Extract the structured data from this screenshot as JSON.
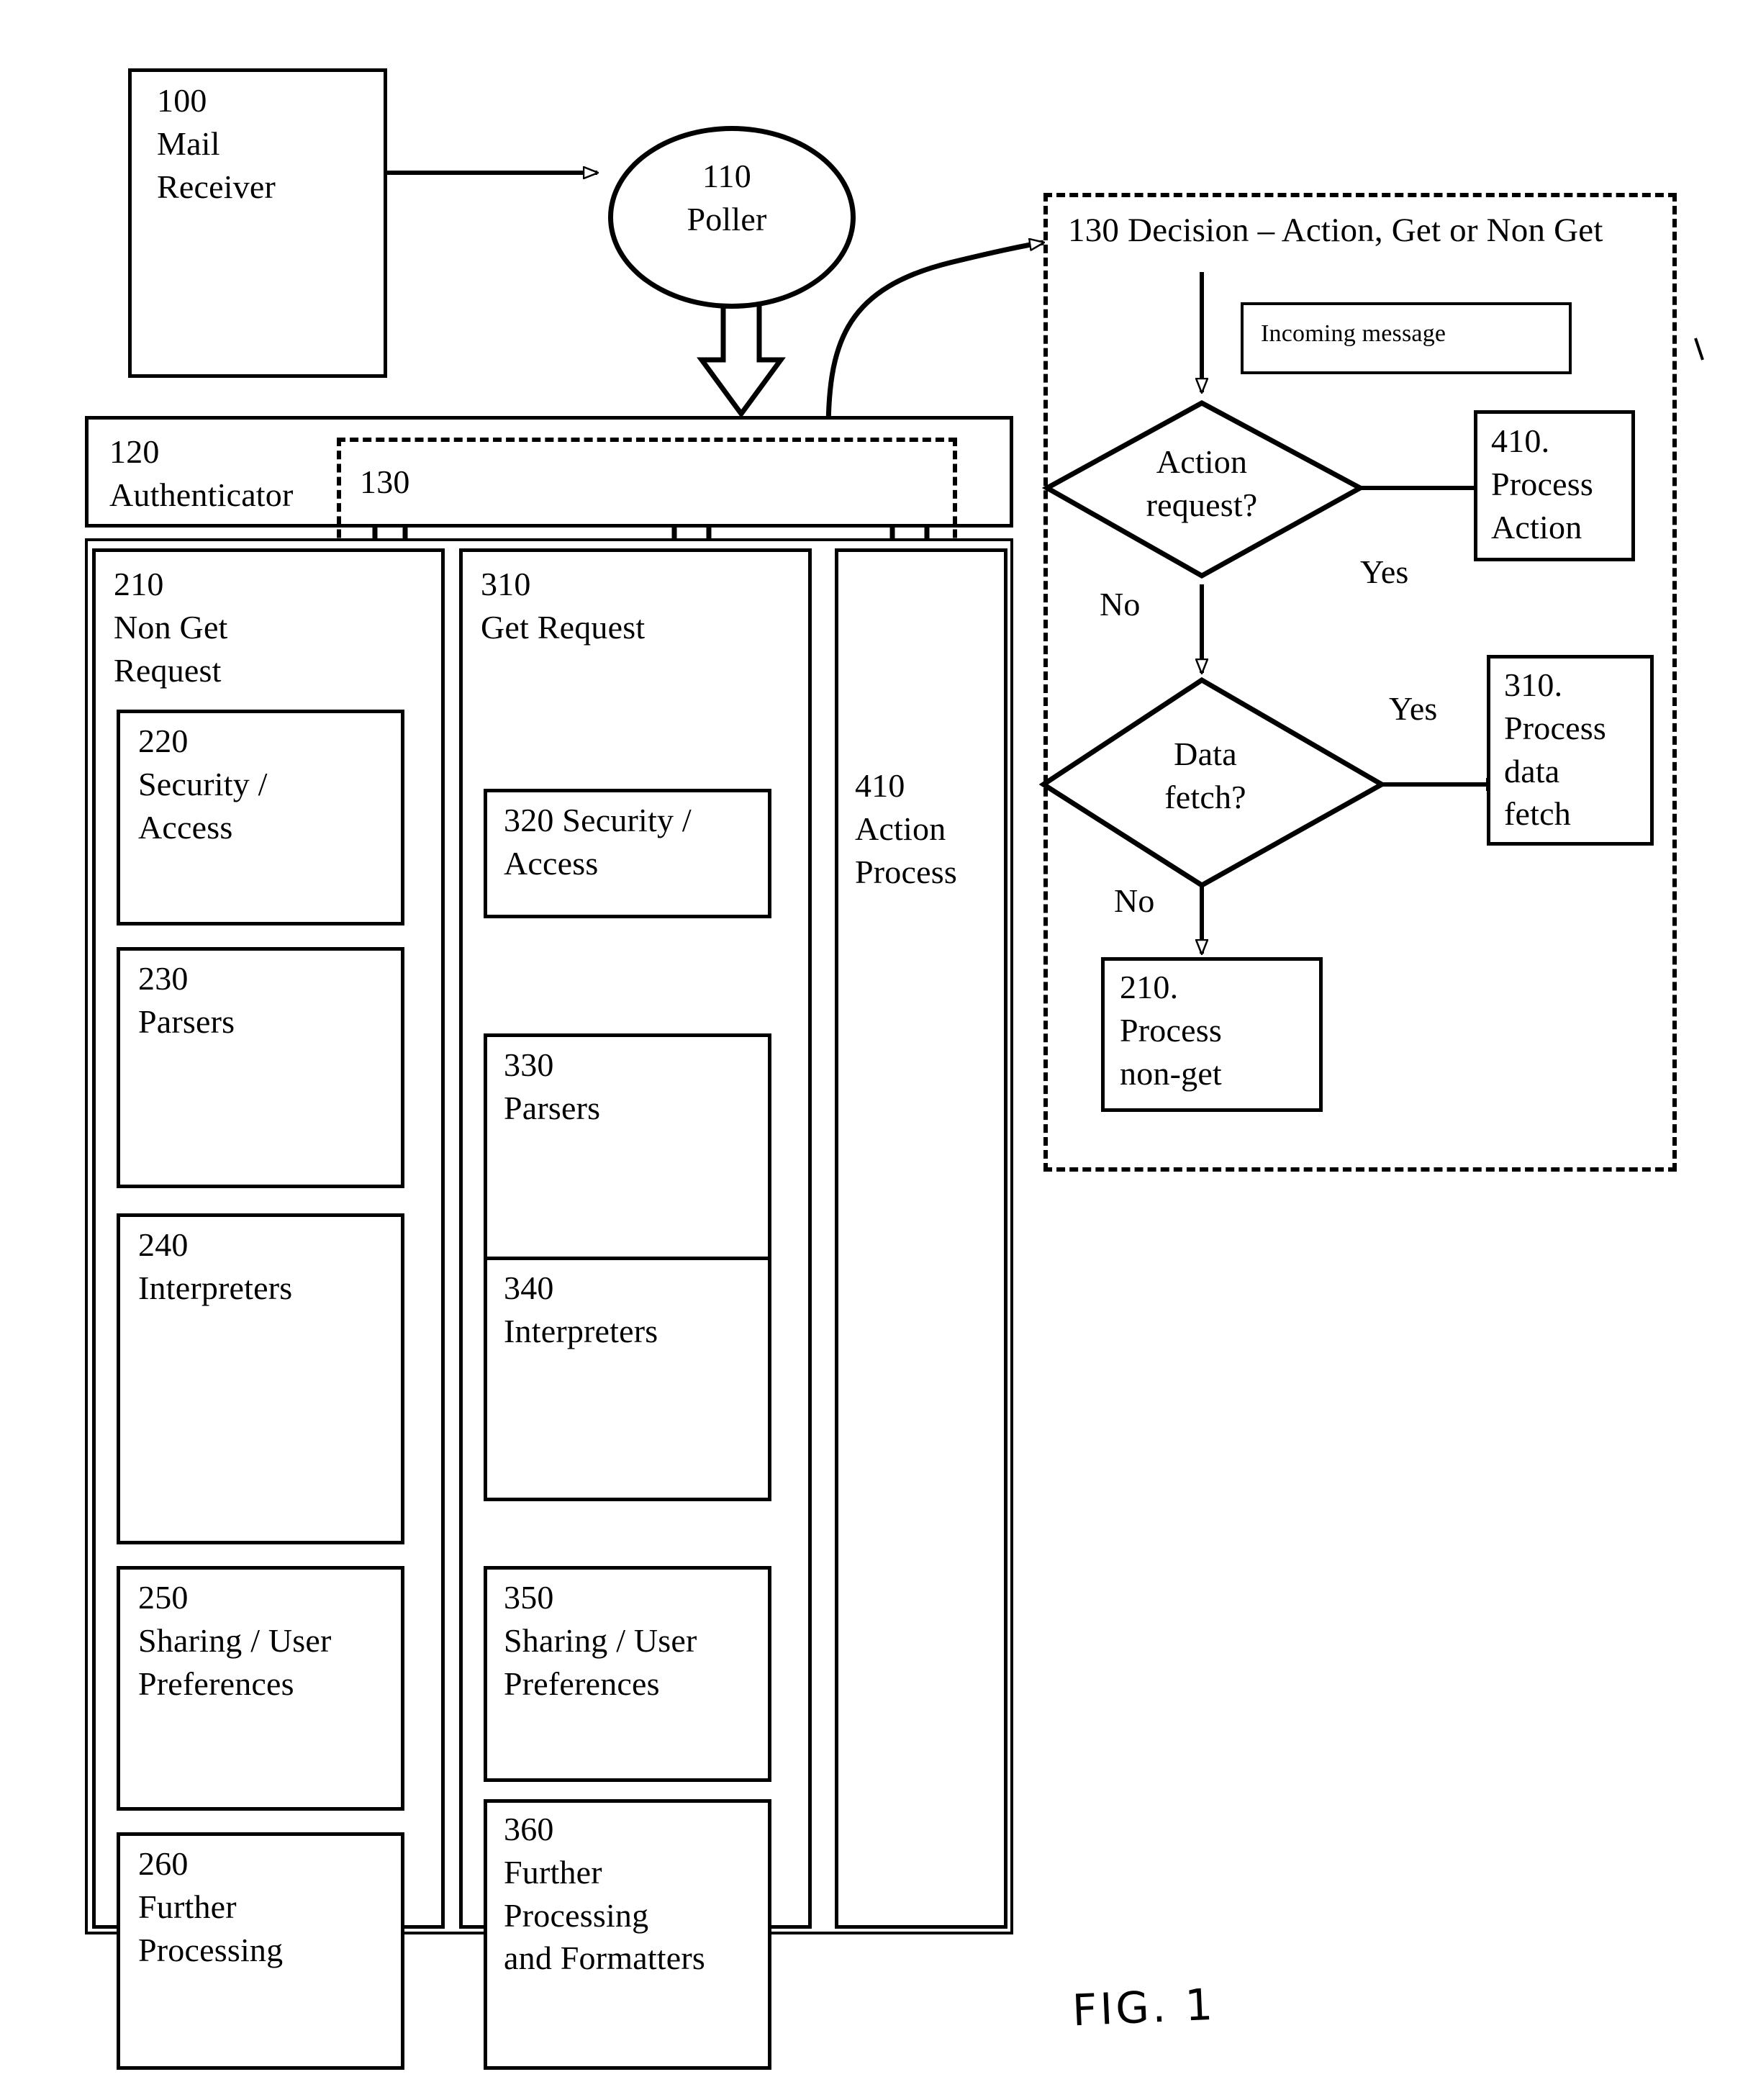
{
  "figure": {
    "label": "FIG. 1",
    "title": "Mail processing architecture block diagram"
  },
  "nodes": {
    "mail_receiver": {
      "id": "100",
      "name": "Mail\nReceiver",
      "text": "100\nMail\nReceiver"
    },
    "poller": {
      "id": "110",
      "name": "Poller",
      "text": "110\nPoller"
    },
    "authenticator": {
      "id": "120",
      "name": "Authenticator",
      "text": "120\nAuthenticator"
    },
    "decision_inline": {
      "id": "130",
      "text": "130"
    },
    "non_get_request": {
      "id": "210",
      "name": "Non Get Request",
      "text": "210\nNon Get\nRequest"
    },
    "get_request": {
      "id": "310",
      "name": "Get Request",
      "text": "310\nGet Request"
    },
    "action_process": {
      "id": "410",
      "name": "Action Process",
      "text": "410\nAction\nProcess"
    },
    "security_access_nonget": {
      "id": "220",
      "text": "220\nSecurity /\nAccess"
    },
    "parsers_nonget": {
      "id": "230",
      "text": "230\nParsers"
    },
    "interpreters_nonget": {
      "id": "240",
      "text": "240\nInterpreters"
    },
    "sharing_prefs_nonget": {
      "id": "250",
      "text": "250\nSharing / User\nPreferences"
    },
    "further_processing_nonget": {
      "id": "260",
      "text": "260\nFurther\nProcessing"
    },
    "security_access_get": {
      "id": "320",
      "text": "320 Security /\nAccess"
    },
    "parsers_get": {
      "id": "330",
      "text": "330\nParsers"
    },
    "interpreters_get": {
      "id": "340",
      "text": "340\nInterpreters"
    },
    "sharing_prefs_get": {
      "id": "350",
      "text": "350\nSharing / User\nPreferences"
    },
    "further_processing_get": {
      "id": "360",
      "text": "360\nFurther\nProcessing\nand Formatters"
    }
  },
  "decision_panel": {
    "title": "130 Decision – Action, Get or Non Get",
    "incoming_message": "Incoming message",
    "diamond_action": "Action\nrequest?",
    "diamond_data": "Data\nfetch?",
    "process_action": "410.\nProcess\nAction",
    "process_data_fetch": "310.\nProcess\ndata\nfetch",
    "process_non_get": "210.\nProcess\nnon-get",
    "edge_labels": {
      "action_yes": "Yes",
      "action_no": "No",
      "data_yes": "Yes",
      "data_no": "No"
    }
  },
  "style": {
    "ink": "#000000",
    "paper": "#ffffff"
  }
}
